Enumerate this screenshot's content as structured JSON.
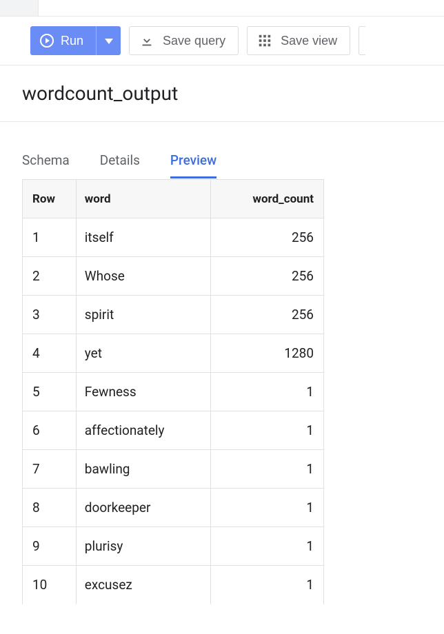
{
  "toolbar": {
    "run_label": "Run",
    "save_query_label": "Save query",
    "save_view_label": "Save view"
  },
  "title": "wordcount_output",
  "tabs": {
    "schema": "Schema",
    "details": "Details",
    "preview": "Preview"
  },
  "table": {
    "headers": {
      "row": "Row",
      "word": "word",
      "word_count": "word_count"
    },
    "rows": [
      {
        "row": "1",
        "word": "itself",
        "word_count": "256"
      },
      {
        "row": "2",
        "word": "Whose",
        "word_count": "256"
      },
      {
        "row": "3",
        "word": "spirit",
        "word_count": "256"
      },
      {
        "row": "4",
        "word": "yet",
        "word_count": "1280"
      },
      {
        "row": "5",
        "word": "Fewness",
        "word_count": "1"
      },
      {
        "row": "6",
        "word": "affectionately",
        "word_count": "1"
      },
      {
        "row": "7",
        "word": "bawling",
        "word_count": "1"
      },
      {
        "row": "8",
        "word": "doorkeeper",
        "word_count": "1"
      },
      {
        "row": "9",
        "word": "plurisy",
        "word_count": "1"
      },
      {
        "row": "10",
        "word": "excusez",
        "word_count": "1"
      }
    ]
  }
}
